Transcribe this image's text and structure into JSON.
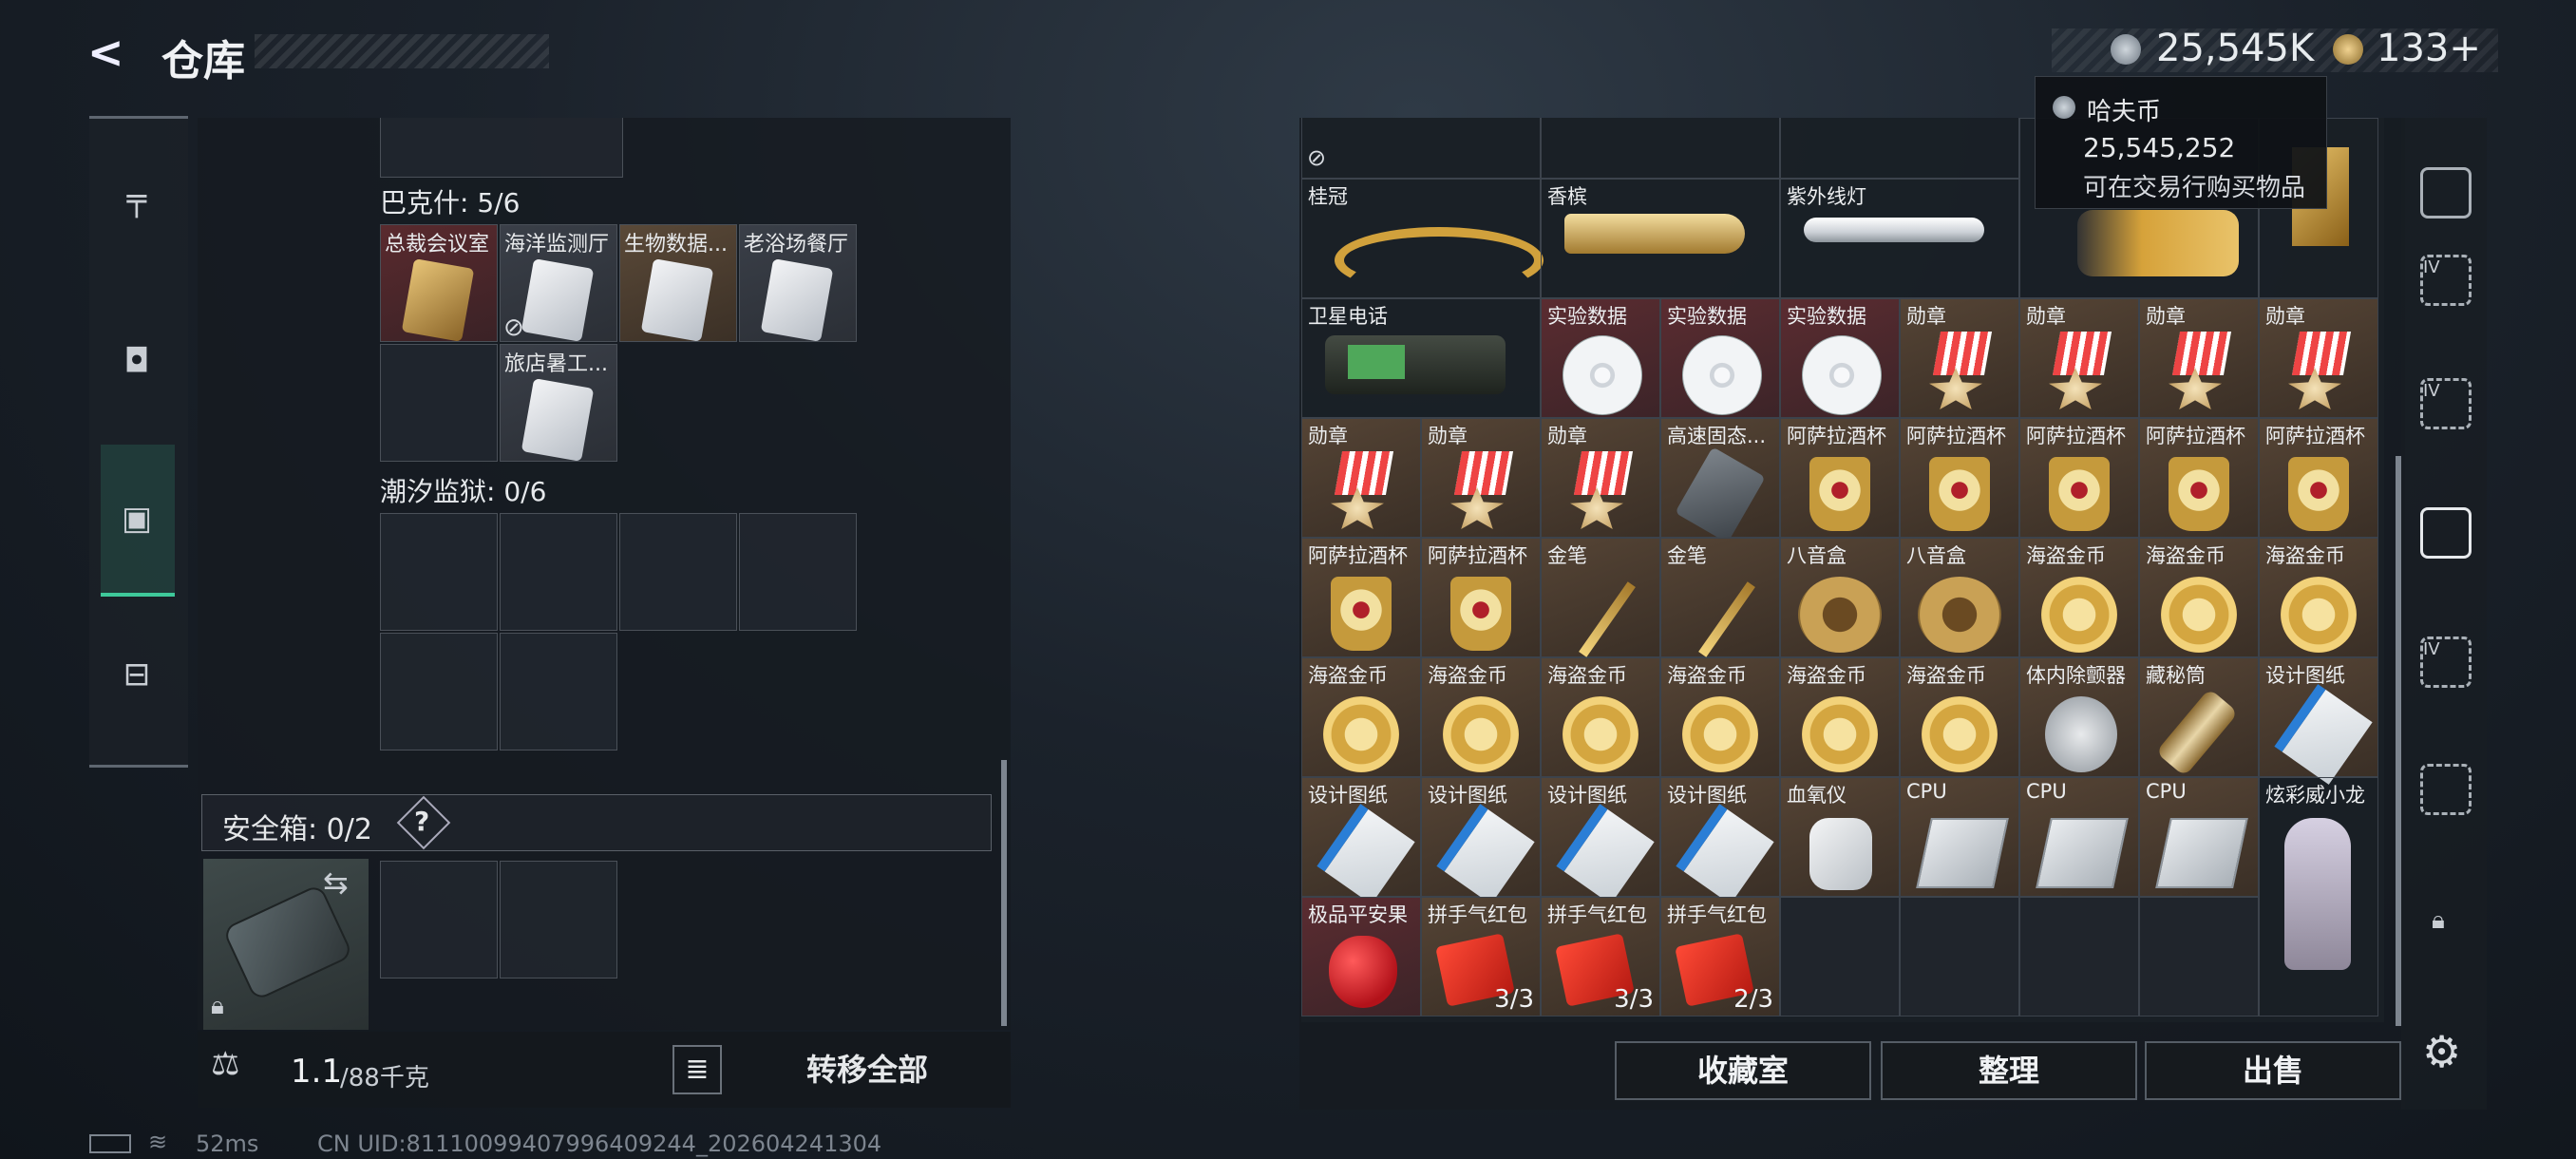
{
  "header": {
    "back": "<",
    "title": "仓库"
  },
  "currency": {
    "coin_a": "25,545K",
    "coin_b": "133",
    "coin_b_plus": "+"
  },
  "tooltip": {
    "title": "哈夫币",
    "value": "25,545,252",
    "desc": "可在交易行购买物品"
  },
  "nav_icons": [
    "gun-icon",
    "armor-icon",
    "backpack-icon",
    "briefcase-icon"
  ],
  "left": {
    "section1": {
      "title": "巴克什: 5/6",
      "cards": [
        "总裁会议室",
        "海洋监测厅",
        "生物数据...",
        "老浴场餐厅",
        "旅店暑工..."
      ]
    },
    "section2": {
      "title": "潮汐监狱: 0/6"
    },
    "safe_box": {
      "label": "安全箱: 0/2",
      "help": "?"
    },
    "weight": {
      "current": "1.1",
      "max": "/88千克"
    },
    "transfer_all": "转移全部"
  },
  "grid": {
    "row1": [
      "桂冠",
      "香槟",
      "紫外线灯"
    ],
    "row2": [
      "卫星电话",
      "实验数据",
      "实验数据",
      "实验数据",
      "勋章",
      "勋章",
      "勋章",
      "勋章"
    ],
    "row3": [
      "勋章",
      "勋章",
      "勋章",
      "高速固态...",
      "阿萨拉酒杯",
      "阿萨拉酒杯",
      "阿萨拉酒杯",
      "阿萨拉酒杯",
      "阿萨拉酒杯"
    ],
    "row4": [
      "阿萨拉酒杯",
      "阿萨拉酒杯",
      "金笔",
      "金笔",
      "八音盒",
      "八音盒",
      "海盗金币",
      "海盗金币",
      "海盗金币"
    ],
    "row5": [
      "海盗金币",
      "海盗金币",
      "海盗金币",
      "海盗金币",
      "海盗金币",
      "海盗金币",
      "体内除颤器",
      "藏秘筒",
      "设计图纸"
    ],
    "row6": [
      "设计图纸",
      "设计图纸",
      "设计图纸",
      "设计图纸",
      "血氧仪",
      "CPU",
      "CPU",
      "CPU"
    ],
    "row7": [
      "极品平安果",
      "拼手气红包",
      "拼手气红包",
      "拼手气红包"
    ],
    "row7_counts": [
      "",
      "3/3",
      "3/3",
      "2/3"
    ],
    "figure": "炫彩威小龙"
  },
  "actions": {
    "collection": "收藏室",
    "sort": "整理",
    "sell": "出售"
  },
  "status": {
    "ping": "52ms",
    "uid": "CN UID:81110099407996409244_202604241304"
  }
}
